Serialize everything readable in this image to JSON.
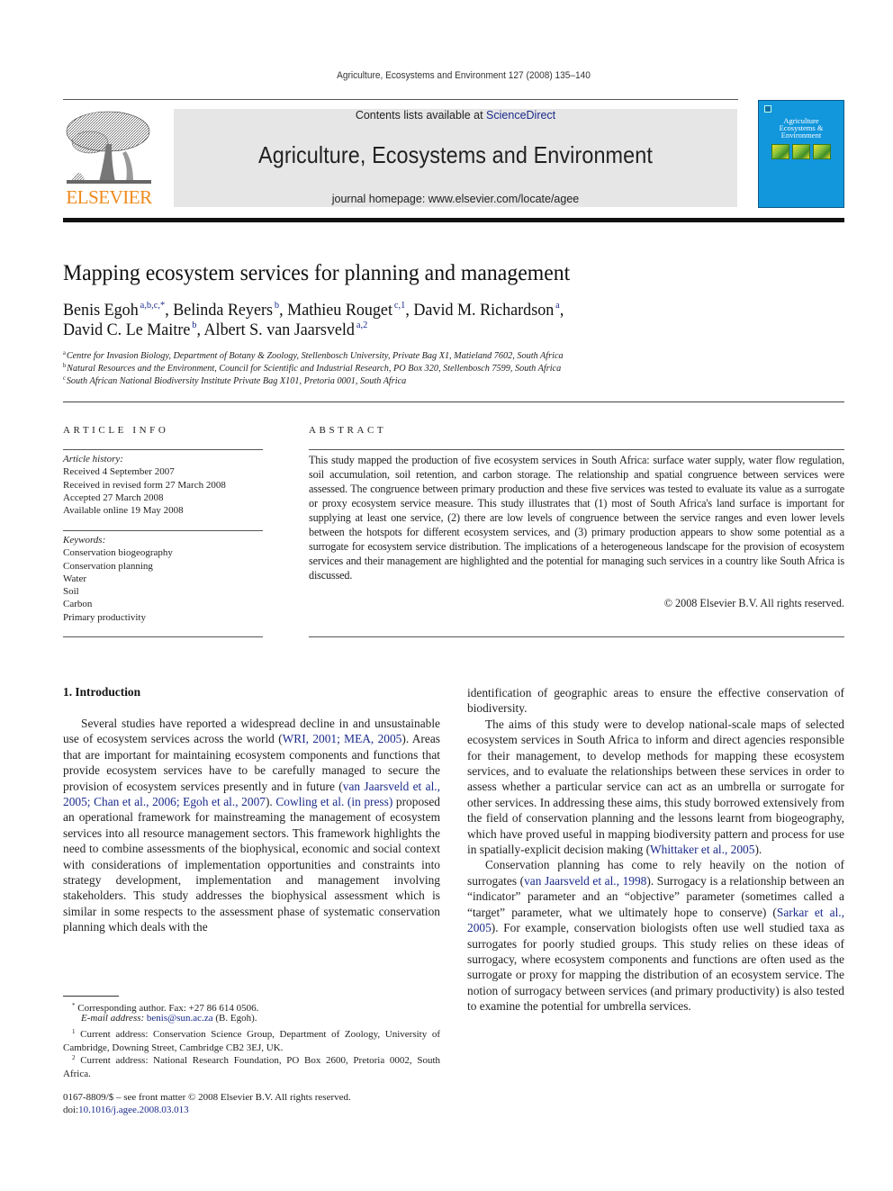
{
  "running_head": "Agriculture, Ecosystems and Environment 127 (2008) 135–140",
  "publisher": {
    "logo_word": "ELSEVIER",
    "logo_icon": "tree-engraving-icon",
    "brand_color": "#f08a1c"
  },
  "banner": {
    "contents_prefix": "Contents lists available at ",
    "contents_link": "ScienceDirect",
    "journal_title": "Agriculture, Ecosystems and Environment",
    "homepage_prefix": "journal homepage: ",
    "homepage_url": "www.elsevier.com/locate/agee",
    "background_color": "#e6e6e6"
  },
  "cover": {
    "title_lines": [
      "Agriculture",
      "Ecosystems &",
      "Environment"
    ],
    "color": "#1296dc"
  },
  "article": {
    "title": "Mapping ecosystem services for planning and management",
    "authors_line1": [
      {
        "name": "Benis Egoh",
        "sup": "a,b,c,*",
        "sep": ", "
      },
      {
        "name": "Belinda Reyers",
        "sup": "b",
        "sep": ", "
      },
      {
        "name": "Mathieu Rouget",
        "sup": "c,1",
        "sep": ", "
      },
      {
        "name": "David M. Richardson",
        "sup": "a",
        "sep": ","
      }
    ],
    "authors_line2": [
      {
        "name": "David C. Le Maitre",
        "sup": "b",
        "sep": ", "
      },
      {
        "name": "Albert S. van Jaarsveld",
        "sup": "a,2",
        "sep": ""
      }
    ],
    "affiliations": [
      {
        "mark": "a",
        "text": "Centre for Invasion Biology, Department of Botany & Zoology, Stellenbosch University, Private Bag X1, Matieland 7602, South Africa"
      },
      {
        "mark": "b",
        "text": "Natural Resources and the Environment, Council for Scientific and Industrial Research, PO Box 320, Stellenbosch 7599, South Africa"
      },
      {
        "mark": "c",
        "text": "South African National Biodiversity Institute Private Bag X101, Pretoria 0001, South Africa"
      }
    ]
  },
  "article_info": {
    "heading": "ARTICLE INFO",
    "history_label": "Article history:",
    "history": [
      "Received 4 September 2007",
      "Received in revised form 27 March 2008",
      "Accepted 27 March 2008",
      "Available online 19 May 2008"
    ],
    "keywords_label": "Keywords:",
    "keywords": [
      "Conservation biogeography",
      "Conservation planning",
      "Water",
      "Soil",
      "Carbon",
      "Primary productivity"
    ]
  },
  "abstract": {
    "heading": "ABSTRACT",
    "text": "This study mapped the production of five ecosystem services in South Africa: surface water supply, water flow regulation, soil accumulation, soil retention, and carbon storage. The relationship and spatial congruence between services were assessed. The congruence between primary production and these five services was tested to evaluate its value as a surrogate or proxy ecosystem service measure. This study illustrates that (1) most of South Africa's land surface is important for supplying at least one service, (2) there are low levels of congruence between the service ranges and even lower levels between the hotspots for different ecosystem services, and (3) primary production appears to show some potential as a surrogate for ecosystem service distribution. The implications of a heterogeneous landscape for the provision of ecosystem services and their management are highlighted and the potential for managing such services in a country like South Africa is discussed.",
    "copyright": "© 2008 Elsevier B.V. All rights reserved."
  },
  "intro": {
    "heading": "1.  Introduction",
    "p1": [
      {
        "t": "Several studies have reported a widespread decline in and unsustainable use of ecosystem services across the world ("
      },
      {
        "t": "WRI, 2001; MEA, 2005",
        "link": true
      },
      {
        "t": "). Areas that are important for maintaining ecosystem components and functions that provide ecosystem services have to be carefully managed to secure the provision of ecosystem services presently and in future ("
      },
      {
        "t": "van Jaarsveld et al., 2005; Chan et al., 2006; Egoh et al., 2007",
        "link": true
      },
      {
        "t": "). "
      },
      {
        "t": "Cowling et al. (in press)",
        "link": true
      },
      {
        "t": " proposed an operational framework for mainstreaming the management of ecosystem services into all resource management sectors. This framework highlights the need to combine assessments of the biophysical, economic and social context with considerations of implementation opportunities and constraints into strategy development, implementation and management involving stakeholders. This study addresses the biophysical assessment which is similar in some respects to the assessment phase of systematic conservation planning which deals with the"
      }
    ],
    "p1_cont": "identification of geographic areas to ensure the effective conservation of biodiversity.",
    "p2": [
      {
        "t": "The aims of this study were to develop national-scale maps of selected ecosystem services in South Africa to inform and direct agencies responsible for their management, to develop methods for mapping these ecosystem services, and to evaluate the relationships between these services in order to assess whether a particular service can act as an umbrella or surrogate for other services. In addressing these aims, this study borrowed extensively from the field of conservation planning and the lessons learnt from biogeography, which have proved useful in mapping biodiversity pattern and process for use in spatially-explicit decision making ("
      },
      {
        "t": "Whittaker et al., 2005",
        "link": true
      },
      {
        "t": ")."
      }
    ],
    "p3": [
      {
        "t": "Conservation planning has come to rely heavily on the notion of surrogates ("
      },
      {
        "t": "van Jaarsveld et al., 1998",
        "link": true
      },
      {
        "t": "). Surrogacy is a relationship between an “indicator” parameter and an “objective” parameter (sometimes called a “target” parameter, what we ultimately hope to conserve) ("
      },
      {
        "t": "Sarkar et al., 2005",
        "link": true
      },
      {
        "t": "). For example, conservation biologists often use well studied taxa as surrogates for poorly studied groups. This study relies on these ideas of surrogacy, where ecosystem components and functions are often used as the surrogate or proxy for mapping the distribution of an ecosystem service. The notion of surrogacy between services (and primary productivity) is also tested to examine the potential for umbrella services."
      }
    ]
  },
  "footnotes": {
    "corresponding": {
      "mark": "*",
      "text": "Corresponding author. Fax: +27 86 614 0506."
    },
    "email_label": "E-mail address: ",
    "email": "benis@sun.ac.za",
    "email_suffix": " (B. Egoh).",
    "fn1": {
      "mark": "1",
      "text": "Current address: Conservation Science Group, Department of Zoology, University of Cambridge, Downing Street, Cambridge CB2 3EJ, UK."
    },
    "fn2": {
      "mark": "2",
      "text": "Current address: National Research Foundation, PO Box 2600, Pretoria 0002, South Africa."
    }
  },
  "front_matter": {
    "issn_line": "0167-8809/$ – see front matter © 2008 Elsevier B.V. All rights reserved.",
    "doi_prefix": "doi:",
    "doi": "10.1016/j.agee.2008.03.013"
  },
  "colors": {
    "link": "#1a2a8a"
  }
}
